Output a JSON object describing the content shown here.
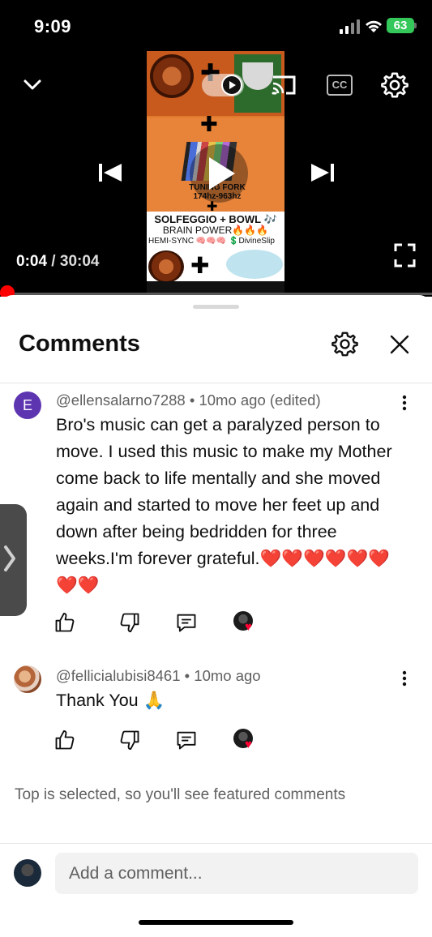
{
  "status_bar": {
    "time": "9:09",
    "battery": "63"
  },
  "player": {
    "current_time": "0:04",
    "separator": " / ",
    "duration": "30:04",
    "progress_fraction": 0.0022,
    "cc_label": "CC",
    "thumbnail": {
      "fork_caption": "TUNING FORK",
      "fork_range": "174hz-963hz",
      "line1": "SOLFEGGIO + BOWL 🎶",
      "line2": "BRAIN POWER🔥🔥🔥",
      "line3": "HEMI-SYNC 🧠🧠🧠 💲DivineSlip"
    }
  },
  "comments_panel": {
    "title": "Comments",
    "items": [
      {
        "avatar_letter": "E",
        "avatar_color": "#5e35b1",
        "author": "@ellensalarno7288",
        "meta_sep": " • ",
        "age": "10mo ago (edited)",
        "text": "Bro's music can get a paralyzed person to move. I used this music to make my Mother come back to life mentally and she moved again and started to move her feet up and down after being bedridden for three weeks.I'm forever grateful.❤️❤️❤️❤️❤️❤️❤️❤️"
      },
      {
        "author": "@fellicialubisi8461",
        "meta_sep": " • ",
        "age": "10mo ago",
        "text": "Thank You 🙏"
      }
    ],
    "sort_hint": "Top is selected, so you'll see featured comments",
    "add_comment_placeholder": "Add a comment..."
  },
  "icons": {
    "like": "thumbs-up-icon",
    "dislike": "thumbs-down-icon",
    "reply": "reply-icon",
    "creator_heart": "creator-heart-icon",
    "settings": "gear-icon",
    "close": "close-icon",
    "more": "more-vert-icon"
  },
  "colors": {
    "accent": "#ff0000",
    "heart": "#ff0033",
    "text_secondary": "#606060"
  }
}
